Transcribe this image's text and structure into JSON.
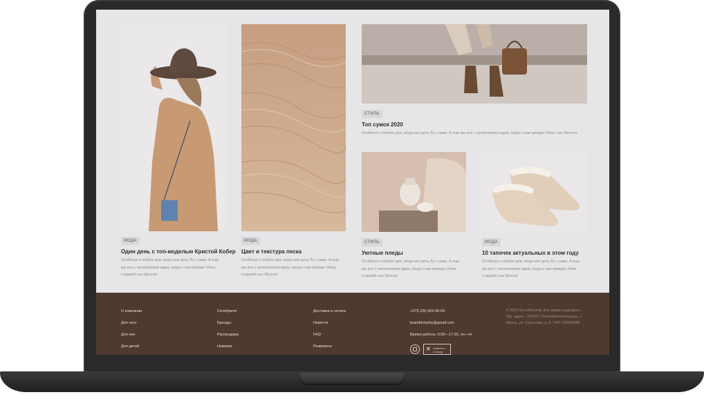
{
  "cards": [
    {
      "tag": "МОДА",
      "title": "Один день с топ-моделью Кристой Кобер",
      "desc": [
        "Особенно я люблю дни, когда моя дочь Лу с нами. А еще",
        "мы все с нетерпением ждем, когда к нам приедет Илия,",
        "старший сын Ирэсли."
      ]
    },
    {
      "tag": "МОДА",
      "title": "Цвет и текстура песка",
      "desc": [
        "Особенно я люблю дни, когда моя дочь Лу с нами. А еще",
        "мы все с нетерпением ждем, когда к нам приедет Илия,",
        "старший сын Ирэсли."
      ]
    },
    {
      "tag": "СТИЛЬ",
      "title": "Топ сумок 2020",
      "desc": [
        "Особенно я люблю дни, когда моя дочь Лу с нами. А еще мы все с нетерпением ждем, когда к нам приедет Илия, сын Ирэсли."
      ]
    },
    {
      "tag": "СТИЛЬ",
      "title": "Уютные пледы",
      "desc": [
        "Особенно я люблю дни, когда моя дочь Лу с нами. А еще",
        "мы все с нетерпением ждем, когда к нам приедет Илия,",
        "старший сын Ирэсли."
      ]
    },
    {
      "tag": "МОДА",
      "title": "10 тапочек актуальных в этом году",
      "desc": [
        "Особенно я люблю дни, когда моя дочь Лу с нами. А еще",
        "мы все с нетерпением ждем, когда к нам приедет Илия,",
        "старший сын Ирэсли."
      ]
    }
  ],
  "footer": {
    "col1": [
      "О компании",
      "Для него",
      "Для нее",
      "Для детей"
    ],
    "col2": [
      "Селебрити",
      "Бренды",
      "Распродажа",
      "Новинки"
    ],
    "col3": [
      "Доставка и оплата",
      "Новости",
      "FAQ",
      "Реквизиты"
    ],
    "phone": "+375 (29) 606-66-06",
    "email": "brand4charity@gmail.com",
    "hours": "Время работы: 9:00—17:30, пн—пт",
    "badge_text": "Raiffeisen Leasing",
    "copyright": [
      "© 2020 Brand4charity. Все права защищены.",
      "Юр. адрес.: 220072, Республика Беларусь, г.",
      "Минск, ул. Сурганова, д. 6, УНП 100003888"
    ]
  },
  "colors": {
    "footer_bg": "#4f3a2f",
    "page_bg": "#e6e6e8",
    "frame": "#2a2a2a"
  },
  "icons": {
    "social": "instagram-icon",
    "partner": "raiffeisen-logo"
  }
}
